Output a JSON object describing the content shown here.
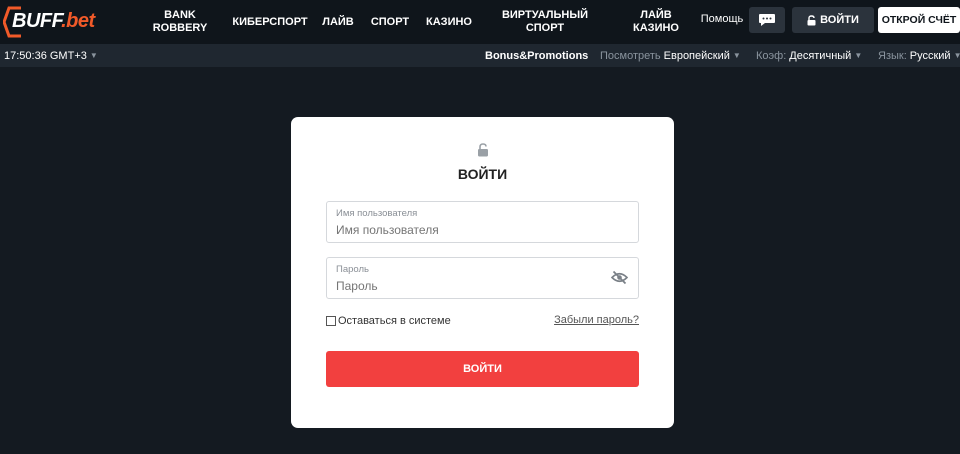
{
  "header": {
    "logo_main": "BUFF",
    "logo_dot": ".",
    "logo_suffix": "bet",
    "nav": [
      {
        "label": "BANK\nROBBERY"
      },
      {
        "label": "КИБЕРСПОРТ"
      },
      {
        "label": "ЛАЙВ"
      },
      {
        "label": "СПОРТ"
      },
      {
        "label": "КАЗИНО"
      },
      {
        "label": "ВИРТУАЛЬНЫЙ\nСПОРТ"
      },
      {
        "label": "ЛАЙВ\nКАЗИНО"
      }
    ],
    "help_label": "Помощь",
    "chat_icon": "chat-bubble-icon",
    "login_label": "ВОЙТИ",
    "register_label": "ОТКРОЙ СЧЁТ"
  },
  "subbar": {
    "time": "17:50:36 GMT+3",
    "bonus_label": "Bonus&Promotions",
    "view_label": "Посмотреть",
    "view_value": "Европейский",
    "odds_label": "Коэф:",
    "odds_value": "Десятичный",
    "lang_label": "Язык:",
    "lang_value": "Русский"
  },
  "login_form": {
    "title": "ВОЙТИ",
    "username_label": "Имя пользователя",
    "username_placeholder": "Имя пользователя",
    "password_label": "Пароль",
    "password_placeholder": "Пароль",
    "remember_label": "Оставаться в системе",
    "forgot_label": "Забыли пароль?",
    "submit_label": "ВОЙТИ"
  },
  "colors": {
    "background": "#141a21",
    "topbar": "#0f151b",
    "accent": "#f2403f",
    "brand_orange": "#f15a29"
  }
}
